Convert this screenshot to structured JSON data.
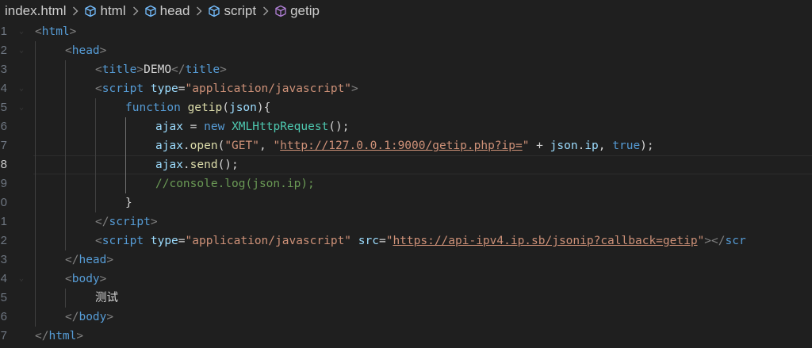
{
  "breadcrumb": {
    "file": "index.html",
    "items": [
      {
        "label": "html",
        "icon": "element-cube-icon"
      },
      {
        "label": "head",
        "icon": "element-cube-icon"
      },
      {
        "label": "script",
        "icon": "element-cube-icon"
      },
      {
        "label": "getip",
        "icon": "function-cube-icon"
      }
    ]
  },
  "editor": {
    "current_line": 8,
    "colors": {
      "background": "#1f1f1f",
      "tag": "#569cd6",
      "attribute": "#9cdcfe",
      "string": "#ce9178",
      "function": "#dcdcaa",
      "class": "#4ec9b0",
      "comment": "#6a9955",
      "punctuation": "#808080"
    },
    "lines": [
      {
        "num": "1",
        "t": [
          "<",
          "html",
          ">"
        ]
      },
      {
        "num": "2",
        "t": [
          "<",
          "head",
          ">"
        ]
      },
      {
        "num": "3",
        "t": [
          "<",
          "title",
          ">",
          "DEMO",
          "</",
          "title",
          ">"
        ]
      },
      {
        "num": "4",
        "t": [
          "<",
          "script",
          " ",
          "type",
          "=",
          "\"application/javascript\"",
          ">"
        ]
      },
      {
        "num": "5",
        "t": [
          "function",
          " ",
          "getip",
          "(",
          "json",
          "){"
        ]
      },
      {
        "num": "6",
        "t": [
          "ajax",
          " = ",
          "new",
          " ",
          "XMLHttpRequest",
          "();"
        ]
      },
      {
        "num": "7",
        "t": [
          "ajax",
          ".",
          "open",
          "(",
          "\"GET\"",
          ", ",
          "\"",
          "http://127.0.0.1:9000/getip.php?ip=",
          "\"",
          " + ",
          "json",
          ".",
          "ip",
          ", ",
          "true",
          ");"
        ]
      },
      {
        "num": "8",
        "t": [
          "ajax",
          ".",
          "send",
          "();"
        ]
      },
      {
        "num": "9",
        "t": [
          "//console.log(json.ip);"
        ]
      },
      {
        "num": "0",
        "t": [
          "}"
        ]
      },
      {
        "num": "1",
        "t": [
          "</",
          "script",
          ">"
        ]
      },
      {
        "num": "2",
        "t": [
          "<",
          "script",
          " ",
          "type",
          "=",
          "\"application/javascript\"",
          " ",
          "src",
          "=",
          "\"",
          "https://api-ipv4.ip.sb/jsonip?callback=getip",
          "\"",
          "></",
          "scr"
        ]
      },
      {
        "num": "3",
        "t": [
          "</",
          "head",
          ">"
        ]
      },
      {
        "num": "4",
        "t": [
          "<",
          "body",
          ">"
        ]
      },
      {
        "num": "5",
        "t": [
          "测试"
        ]
      },
      {
        "num": "6",
        "t": [
          "</",
          "body",
          ">"
        ]
      },
      {
        "num": "7",
        "t": [
          "</",
          "html",
          ">"
        ]
      }
    ]
  }
}
